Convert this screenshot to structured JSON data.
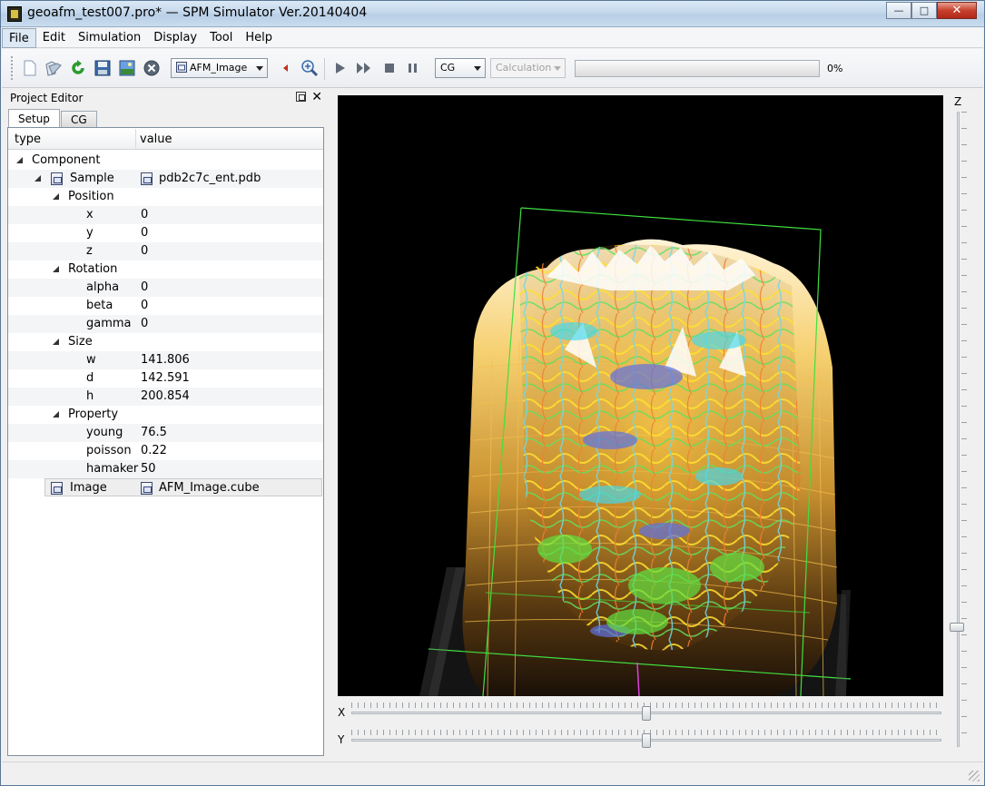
{
  "window": {
    "title": "geoafm_test007.pro* — SPM Simulator Ver.20140404",
    "minimize": "—",
    "maximize": "□",
    "close": "✕"
  },
  "menu": [
    "File",
    "Edit",
    "Simulation",
    "Display",
    "Tool",
    "Help"
  ],
  "toolbar": {
    "image_combo": "AFM_Image",
    "mode_combo": "CG",
    "calc_combo": "Calculation",
    "progress_text": "0%",
    "progress_value": 0
  },
  "project_editor": {
    "title": "Project Editor",
    "close": "✕",
    "tabs": [
      "Setup",
      "CG"
    ],
    "columns": {
      "type": "type",
      "value": "value"
    },
    "rows": [
      {
        "label": "Component",
        "value": ""
      },
      {
        "label": "Sample",
        "value": "pdb2c7c_ent.pdb"
      },
      {
        "label": "Position",
        "value": ""
      },
      {
        "label": "x",
        "value": "0"
      },
      {
        "label": "y",
        "value": "0"
      },
      {
        "label": "z",
        "value": "0"
      },
      {
        "label": "Rotation",
        "value": ""
      },
      {
        "label": "alpha",
        "value": "0"
      },
      {
        "label": "beta",
        "value": "0"
      },
      {
        "label": "gamma",
        "value": "0"
      },
      {
        "label": "Size",
        "value": ""
      },
      {
        "label": "w",
        "value": "141.806"
      },
      {
        "label": "d",
        "value": "142.591"
      },
      {
        "label": "h",
        "value": "200.854"
      },
      {
        "label": "Property",
        "value": ""
      },
      {
        "label": "young",
        "value": "76.5"
      },
      {
        "label": "poisson",
        "value": "0.22"
      },
      {
        "label": "hamaker",
        "value": "50"
      },
      {
        "label": "Image",
        "value": "AFM_Image.cube"
      }
    ]
  },
  "sliders": {
    "z_label": "Z",
    "x_label": "X",
    "y_label": "Y"
  },
  "colors": {
    "accent": "#5cb83a",
    "viewport_bg": "#000000"
  }
}
